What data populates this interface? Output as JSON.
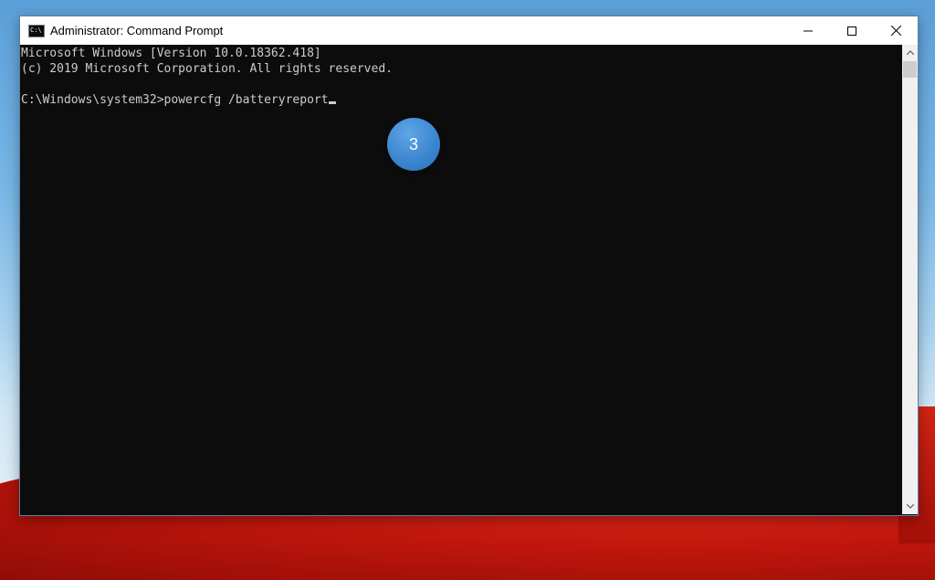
{
  "window": {
    "title": "Administrator: Command Prompt",
    "icon_label": "C:\\",
    "controls": {
      "minimize_icon": "minimize-icon",
      "maximize_icon": "maximize-icon",
      "close_icon": "close-icon"
    }
  },
  "console": {
    "lines": [
      "Microsoft Windows [Version 10.0.18362.418]",
      "(c) 2019 Microsoft Corporation. All rights reserved.",
      "",
      "C:\\Windows\\system32>powercfg /batteryreport"
    ]
  },
  "badge": {
    "number": "3"
  },
  "colors": {
    "console_bg": "#0c0c0c",
    "console_text": "#cccccc",
    "badge": "#3a84cf"
  }
}
